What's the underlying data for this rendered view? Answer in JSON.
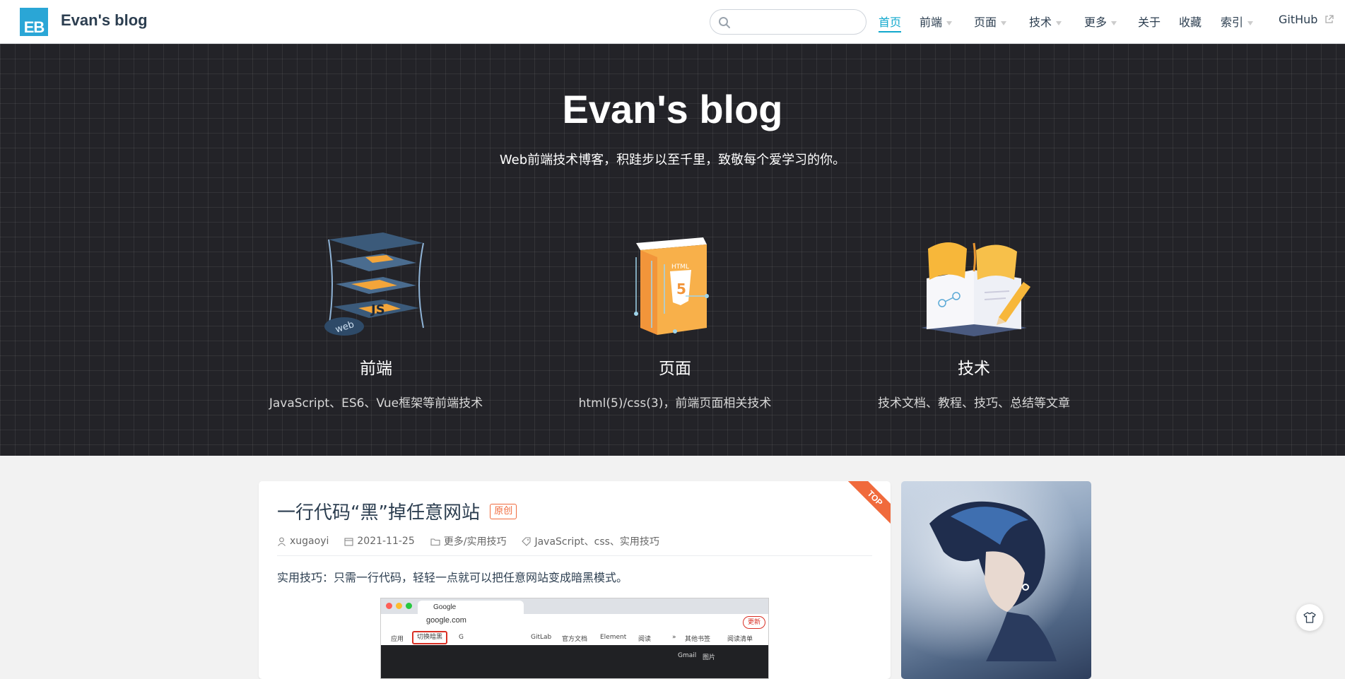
{
  "site": {
    "logo_text": "EB",
    "name": "Evan's blog"
  },
  "search": {
    "placeholder": "",
    "value": ""
  },
  "nav": {
    "items": [
      {
        "label": "首页",
        "active": true
      },
      {
        "label": "前端",
        "dropdown": true
      },
      {
        "label": "页面",
        "dropdown": true
      },
      {
        "label": "技术",
        "dropdown": true
      },
      {
        "label": "更多",
        "dropdown": true
      },
      {
        "label": "关于"
      },
      {
        "label": "收藏"
      },
      {
        "label": "索引",
        "dropdown": true
      },
      {
        "label": "GitHub",
        "external": true
      }
    ]
  },
  "hero": {
    "title": "Evan's blog",
    "description": "Web前端技术博客，积跬步以至千里，致敬每个爱学习的你。",
    "features": [
      {
        "title": "前端",
        "details": "JavaScript、ES6、Vue框架等前端技术",
        "icon": "layered-js-icon"
      },
      {
        "title": "页面",
        "details": "html(5)/css(3)，前端页面相关技术",
        "icon": "html5-page-icon"
      },
      {
        "title": "技术",
        "details": "技术文档、教程、技巧、总结等文章",
        "icon": "open-book-pencil-icon"
      }
    ]
  },
  "post": {
    "title": "一行代码“黑”掉任意网站",
    "badge": "原创",
    "sticky_label": "TOP",
    "author": "xugaoyi",
    "date": "2021-11-25",
    "category": "更多/实用技巧",
    "tags": "JavaScript、css、实用技巧",
    "excerpt": "实用技巧：只需一行代码，轻轻一点就可以把任意网站变成暗黑模式。",
    "screenshot": {
      "tab_title": "Google",
      "url": "google.com",
      "update_label": "更新",
      "bookmarks": [
        "应用",
        "切换暗黑",
        "G",
        "GitLab",
        "官方文档",
        "Element",
        "阅读",
        "»",
        "其他书签",
        "阅读清单"
      ],
      "dark_links": [
        "Gmail",
        "图片"
      ]
    }
  },
  "sidebar": {
    "avatar_alt": "blogger avatar illustration"
  },
  "colors": {
    "accent": "#11a8cd",
    "hero_bg": "#232328",
    "ribbon": "#f06a3c",
    "logo_bg": "#2aa6d6"
  }
}
